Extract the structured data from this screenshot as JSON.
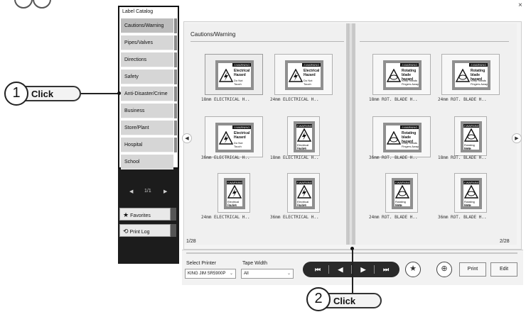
{
  "sidebar": {
    "header": "Label Catalog",
    "categories": [
      "Cautions/Warning",
      "Pipes/Valves",
      "Directions",
      "Safety",
      "Anti-Disaster/Crime",
      "Business",
      "Store/Plant",
      "Hospital",
      "School"
    ],
    "pager": {
      "prev": "◀",
      "label": "1/1",
      "next": "▶"
    },
    "favorites_label": "Favorites",
    "print_log_label": "Print Log"
  },
  "window": {
    "close": "×"
  },
  "catalog": {
    "title": "Cautions/Warning",
    "page_left": "1/28",
    "page_right": "2/28",
    "prev_arrow": "◀",
    "next_arrow": "▶",
    "items": [
      {
        "caption": "18mm ELECTRICAL H..",
        "head": "⚠WARNING",
        "text1": "Electrical",
        "text2": "Hazard",
        "sub": "Do Not Touch",
        "kind": "electrical-wide"
      },
      {
        "caption": "24mm ELECTRICAL H..",
        "head": "⚠WARNING",
        "text1": "Electrical",
        "text2": "Hazard",
        "sub": "Do Not Touch",
        "kind": "electrical-wide"
      },
      {
        "caption": "18mm ROT. BLADE H..",
        "head": "⚠WARNING",
        "text1": "Rotating",
        "text2": "blade hazard",
        "sub": "Keep Hands Fingers Away",
        "kind": "blade-wide"
      },
      {
        "caption": "24mm ROT. BLADE H..",
        "head": "⚠WARNING",
        "text1": "Rotating",
        "text2": "blade hazard",
        "sub": "Keep Hands Fingers Away",
        "kind": "blade-wide"
      },
      {
        "caption": "36mm ELECTRICAL H..",
        "head": "⚠WARNING",
        "text1": "Electrical",
        "text2": "Hazard",
        "sub": "Do Not Touch",
        "kind": "electrical-wide"
      },
      {
        "caption": "18mm ELECTRICAL H..",
        "head": "⚠WARNING",
        "text1": "Electrical Hazard",
        "text2": "",
        "sub": "Do Not Touch",
        "kind": "electrical-tall"
      },
      {
        "caption": "36mm ROT. BLADE H..",
        "head": "⚠WARNING",
        "text1": "Rotating",
        "text2": "blade hazard",
        "sub": "Keep Hands Fingers Away",
        "kind": "blade-wide"
      },
      {
        "caption": "18mm ROT. BLADE H..",
        "head": "⚠WARNING",
        "text1": "Rotating blade",
        "text2": "hazard",
        "sub": "Keep Hands Fingers Away",
        "kind": "blade-tall"
      },
      {
        "caption": "24mm ELECTRICAL H..",
        "head": "⚠WARNING",
        "text1": "Electrical Hazard",
        "text2": "",
        "sub": "Do Not Touch",
        "kind": "electrical-tall"
      },
      {
        "caption": "36mm ELECTRICAL H..",
        "head": "⚠WARNING",
        "text1": "Electrical Hazard",
        "text2": "",
        "sub": "Do Not Touch",
        "kind": "electrical-tall"
      },
      {
        "caption": "24mm ROT. BLADE H..",
        "head": "⚠WARNING",
        "text1": "Rotating blade",
        "text2": "hazard",
        "sub": "Keep Hands Fingers Away",
        "kind": "blade-tall"
      },
      {
        "caption": "36mm ROT. BLADE H..",
        "head": "⚠WARNING",
        "text1": "Rotating blade",
        "text2": "hazard",
        "sub": "Keep Hands Fingers Away",
        "kind": "blade-tall"
      }
    ]
  },
  "bottom": {
    "printer_label": "Select Printer",
    "printer_value": "KING JIM SR5900P",
    "tape_label": "Tape Width",
    "tape_value": "All",
    "first": "⏮",
    "prev": "◀",
    "next": "▶",
    "last": "⏭",
    "favorite_icon": "★",
    "zoom_icon": "⊕",
    "print_label": "Print",
    "edit_label": "Edit"
  },
  "callouts": [
    {
      "number": "1",
      "text": "Click"
    },
    {
      "number": "2",
      "text": "Click"
    }
  ]
}
